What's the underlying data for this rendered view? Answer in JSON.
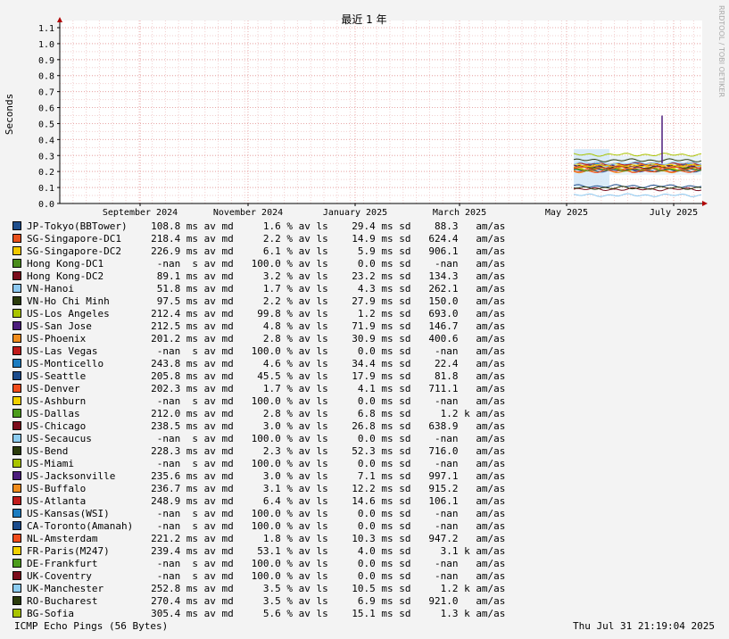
{
  "chart_data": {
    "type": "line",
    "title": "最近 1 年",
    "ylabel": "Seconds",
    "watermark": "RRDTOOL / TOBI OETIKER",
    "ylim": [
      0,
      1.1
    ],
    "yticks": [
      "0.0",
      "0.1",
      "0.2",
      "0.3",
      "0.4",
      "0.5",
      "0.6",
      "0.7",
      "0.8",
      "0.9",
      "1.0",
      "1.1"
    ],
    "xticks": [
      "September 2024",
      "November 2024",
      "January 2025",
      "March 2025",
      "May 2025",
      "July 2025"
    ],
    "grid": true,
    "series": [
      {
        "name": "JP-Tokyo(BBTower)",
        "color": "#1f4e8c",
        "median": "108.8",
        "loss": "1.6",
        "sd": "29.4",
        "am": "88.3",
        "am_unit": ""
      },
      {
        "name": "SG-Singapore-DC1",
        "color": "#e8501c",
        "median": "218.4",
        "loss": "2.2",
        "sd": "14.9",
        "am": "624.4",
        "am_unit": ""
      },
      {
        "name": "SG-Singapore-DC2",
        "color": "#f0c800",
        "median": "226.9",
        "loss": "6.1",
        "sd": "5.9",
        "am": "906.1",
        "am_unit": ""
      },
      {
        "name": "Hong Kong-DC1",
        "color": "#4a8c1c",
        "median": "-nan",
        "loss": "100.0",
        "sd": "0.0",
        "am": "-nan",
        "am_unit": ""
      },
      {
        "name": "Hong Kong-DC2",
        "color": "#7a0c1c",
        "median": "89.1",
        "loss": "3.2",
        "sd": "23.2",
        "am": "134.3",
        "am_unit": ""
      },
      {
        "name": "VN-Hanoi",
        "color": "#8cc8f0",
        "median": "51.8",
        "loss": "1.7",
        "sd": "4.3",
        "am": "262.1",
        "am_unit": ""
      },
      {
        "name": "VN-Ho Chi Minh",
        "color": "#2c3c0c",
        "median": "97.5",
        "loss": "2.2",
        "sd": "27.9",
        "am": "150.0",
        "am_unit": ""
      },
      {
        "name": "US-Los Angeles",
        "color": "#a8c400",
        "median": "212.4",
        "loss": "99.8",
        "sd": "1.2",
        "am": "693.0",
        "am_unit": ""
      },
      {
        "name": "US-San Jose",
        "color": "#4c1c7c",
        "median": "212.5",
        "loss": "4.8",
        "sd": "71.9",
        "am": "146.7",
        "am_unit": ""
      },
      {
        "name": "US-Phoenix",
        "color": "#f08c1c",
        "median": "201.2",
        "loss": "2.8",
        "sd": "30.9",
        "am": "400.6",
        "am_unit": ""
      },
      {
        "name": "US-Las Vegas",
        "color": "#c01c1c",
        "median": "-nan",
        "loss": "100.0",
        "sd": "0.0",
        "am": "-nan",
        "am_unit": ""
      },
      {
        "name": "US-Monticello",
        "color": "#1c7cc0",
        "median": "243.8",
        "loss": "4.6",
        "sd": "34.4",
        "am": "22.4",
        "am_unit": ""
      },
      {
        "name": "US-Seattle",
        "color": "#1c4c8c",
        "median": "205.8",
        "loss": "45.5",
        "sd": "17.9",
        "am": "81.8",
        "am_unit": ""
      },
      {
        "name": "US-Denver",
        "color": "#f04c1c",
        "median": "202.3",
        "loss": "1.7",
        "sd": "4.1",
        "am": "711.1",
        "am_unit": ""
      },
      {
        "name": "US-Ashburn",
        "color": "#f0d000",
        "median": "-nan",
        "loss": "100.0",
        "sd": "0.0",
        "am": "-nan",
        "am_unit": ""
      },
      {
        "name": "US-Dallas",
        "color": "#4c9c1c",
        "median": "212.0",
        "loss": "2.8",
        "sd": "6.8",
        "am": "1.2",
        "am_unit": "k"
      },
      {
        "name": "US-Chicago",
        "color": "#7c0c1c",
        "median": "238.5",
        "loss": "3.0",
        "sd": "26.8",
        "am": "638.9",
        "am_unit": ""
      },
      {
        "name": "US-Secaucus",
        "color": "#8cccf0",
        "median": "-nan",
        "loss": "100.0",
        "sd": "0.0",
        "am": "-nan",
        "am_unit": ""
      },
      {
        "name": "US-Bend",
        "color": "#2c3c0c",
        "median": "228.3",
        "loss": "2.3",
        "sd": "52.3",
        "am": "716.0",
        "am_unit": ""
      },
      {
        "name": "US-Miami",
        "color": "#a8c400",
        "median": "-nan",
        "loss": "100.0",
        "sd": "0.0",
        "am": "-nan",
        "am_unit": ""
      },
      {
        "name": "US-Jacksonville",
        "color": "#4c1c7c",
        "median": "235.6",
        "loss": "3.0",
        "sd": "7.1",
        "am": "997.1",
        "am_unit": ""
      },
      {
        "name": "US-Buffalo",
        "color": "#f08c1c",
        "median": "236.7",
        "loss": "3.1",
        "sd": "12.2",
        "am": "915.2",
        "am_unit": ""
      },
      {
        "name": "US-Atlanta",
        "color": "#c01c1c",
        "median": "248.9",
        "loss": "6.4",
        "sd": "14.6",
        "am": "106.1",
        "am_unit": ""
      },
      {
        "name": "US-Kansas(WSI)",
        "color": "#1c7cc0",
        "median": "-nan",
        "loss": "100.0",
        "sd": "0.0",
        "am": "-nan",
        "am_unit": ""
      },
      {
        "name": "CA-Toronto(Amanah)",
        "color": "#1c4c8c",
        "median": "-nan",
        "loss": "100.0",
        "sd": "0.0",
        "am": "-nan",
        "am_unit": ""
      },
      {
        "name": "NL-Amsterdam",
        "color": "#f04c1c",
        "median": "221.2",
        "loss": "1.8",
        "sd": "10.3",
        "am": "947.2",
        "am_unit": ""
      },
      {
        "name": "FR-Paris(M247)",
        "color": "#f0d000",
        "median": "239.4",
        "loss": "53.1",
        "sd": "4.0",
        "am": "3.1",
        "am_unit": "k"
      },
      {
        "name": "DE-Frankfurt",
        "color": "#4c9c1c",
        "median": "-nan",
        "loss": "100.0",
        "sd": "0.0",
        "am": "-nan",
        "am_unit": ""
      },
      {
        "name": "UK-Coventry",
        "color": "#7c0c1c",
        "median": "-nan",
        "loss": "100.0",
        "sd": "0.0",
        "am": "-nan",
        "am_unit": ""
      },
      {
        "name": "UK-Manchester",
        "color": "#8cccf0",
        "median": "252.8",
        "loss": "3.5",
        "sd": "10.5",
        "am": "1.2",
        "am_unit": "k"
      },
      {
        "name": "RO-Bucharest",
        "color": "#2c3c0c",
        "median": "270.4",
        "loss": "3.5",
        "sd": "6.9",
        "am": "921.0",
        "am_unit": ""
      },
      {
        "name": "BG-Sofia",
        "color": "#a8c400",
        "median": "305.4",
        "loss": "5.6",
        "sd": "15.1",
        "am": "1.3",
        "am_unit": "k"
      }
    ]
  },
  "footer": {
    "left": "ICMP Echo Pings (56 Bytes)",
    "right": "Thu Jul 31 21:19:04 2025"
  }
}
